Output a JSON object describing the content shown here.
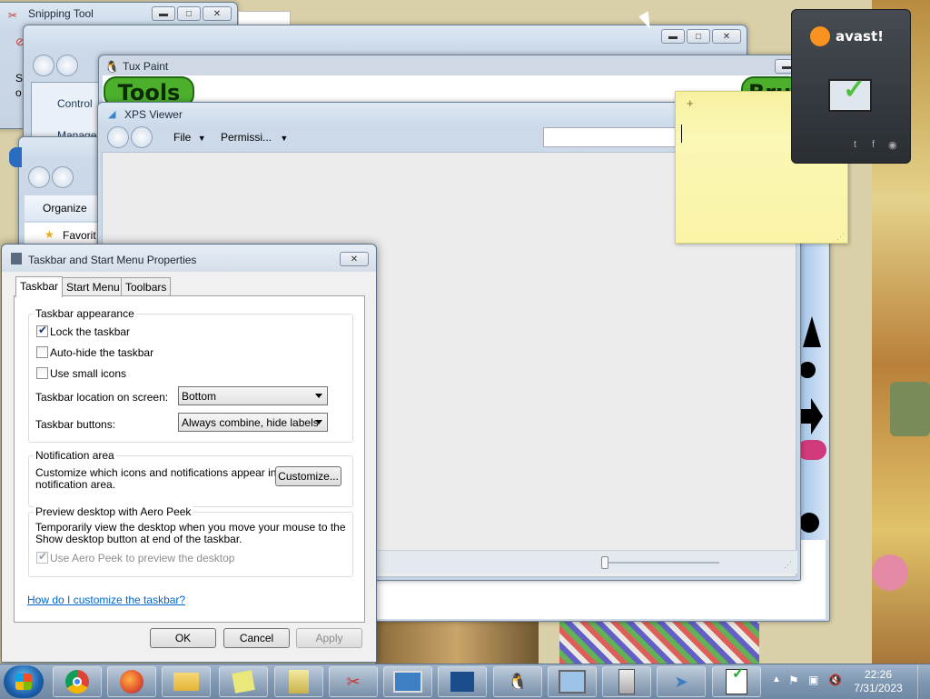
{
  "snipping": {
    "title": "Snipping Tool",
    "frag1": "S",
    "frag2": "o"
  },
  "control_panel": {
    "item1": "Control",
    "item2": "Manage"
  },
  "explorer": {
    "organize": "Organize",
    "favorites": "Favorit"
  },
  "tuxpaint": {
    "title": "Tux Paint",
    "tools": "Tools",
    "brushes": "Brus"
  },
  "xps": {
    "title": "XPS Viewer",
    "menu_file": "File",
    "menu_permissions": "Permissi...",
    "search_placeholder": ""
  },
  "sticky": {
    "add": "+",
    "close": "×"
  },
  "avast": {
    "brand": "avast!"
  },
  "dialog": {
    "title": "Taskbar and Start Menu Properties",
    "tabs": [
      "Taskbar",
      "Start Menu",
      "Toolbars"
    ],
    "appearance": {
      "heading": "Taskbar appearance",
      "lock": {
        "label": "Lock the taskbar",
        "checked": true
      },
      "autohide": {
        "label": "Auto-hide the taskbar",
        "checked": false
      },
      "small_icons": {
        "label": "Use small icons",
        "checked": false
      },
      "location_label": "Taskbar location on screen:",
      "location_value": "Bottom",
      "buttons_label": "Taskbar buttons:",
      "buttons_value": "Always combine, hide labels"
    },
    "notification": {
      "heading": "Notification area",
      "desc_line1": "Customize which icons and notifications appear in the",
      "desc_line2": "notification area.",
      "customize": "Customize..."
    },
    "aero": {
      "heading": "Preview desktop with Aero Peek",
      "desc_line1": "Temporarily view the desktop when you move your mouse to the",
      "desc_line2": "Show desktop button at end of the taskbar.",
      "use_peek": {
        "label": "Use Aero Peek to preview the desktop",
        "checked": true
      }
    },
    "help_link": "How do I customize the taskbar?",
    "ok": "OK",
    "cancel": "Cancel",
    "apply": "Apply"
  },
  "taskbar": {
    "items": [
      "chrome",
      "firefox",
      "explorer",
      "sticky-notes",
      "office",
      "snipping",
      "remote-desktop",
      "xps",
      "tux-paint",
      "control-panel",
      "server",
      "tux-paint-stamp",
      "notepad"
    ],
    "clock_time": "22:26",
    "clock_date": "7/31/2023"
  },
  "colors": {
    "accent": "#0066cc",
    "sticky": "#fbf7b5",
    "avast": "#f7931e"
  }
}
